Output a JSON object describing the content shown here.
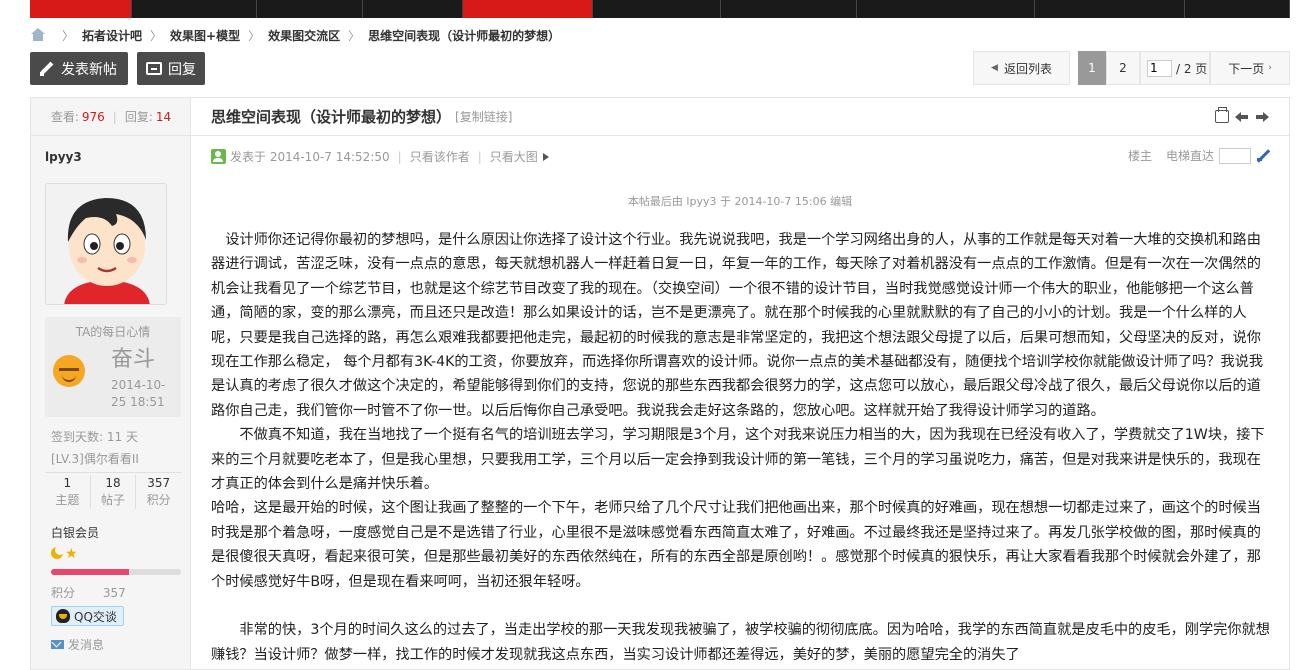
{
  "nav": {
    "items": [
      "",
      "",
      "",
      "",
      "",
      "",
      "",
      "",
      "",
      ""
    ]
  },
  "breadcrumb": [
    "拓者设计吧",
    "效果图+模型",
    "效果图交流区",
    "思维空间表现（设计师最初的梦想）"
  ],
  "actions": {
    "new_post": "发表新帖",
    "reply": "回复"
  },
  "pager": {
    "back": "返回列表",
    "pages": [
      "1",
      "2"
    ],
    "input_value": "1",
    "total": "/ 2 页",
    "next": "下一页"
  },
  "stats": {
    "views_label": "查看:",
    "views": "976",
    "replies_label": "回复:",
    "replies": "14"
  },
  "thread": {
    "title": "思维空间表现（设计师最初的梦想）",
    "copy_link": "[复制链接]"
  },
  "author": {
    "name": "lpyy3",
    "mood_title": "TA的每日心情",
    "mood_word": "奋斗",
    "mood_date": "2014-10-25 18:51",
    "sign_days": "签到天数: 11 天",
    "sign_level": "[LV.3]偶尔看看II",
    "counts": [
      {
        "value": "1",
        "label": "主题"
      },
      {
        "value": "18",
        "label": "帖子"
      },
      {
        "value": "357",
        "label": "积分"
      }
    ],
    "rank": "白银会员",
    "progress": 0.6,
    "points_label": "积分",
    "points": "357",
    "qq": "QQ交谈",
    "message": "发消息"
  },
  "meta": {
    "posted": "发表于 2014-10-7 14:52:50",
    "only_author": "只看该作者",
    "large_image": "只看大图",
    "floor_label": "楼主",
    "jump_label": "电梯直达"
  },
  "edit_note": "本帖最后由 lpyy3 于 2014-10-7 15:06 编辑",
  "content": {
    "paragraphs": [
      "　设计师你还记得你最初的梦想吗，是什么原因让你选择了设计这个行业。我先说说我吧，我是一个学习网络出身的人，从事的工作就是每天对着一大堆的交换机和路由器进行调试，苦涩乏味，没有一点点的意思，每天就想机器人一样赶着日复一日，年复一年的工作，每天除了对着机器没有一点点的工作激情。但是有一次在一次偶然的机会让我看见了一个综艺节目，也就是这个综艺节目改变了我的现在。（交换空间）一个很不错的设计节目，当时我觉感觉设计师一个伟大的职业，他能够把一个这么普通，简陋的家，变的那么漂亮，而且还只是改造！那么如果设计的话，岂不是更漂亮了。就在那个时候我的心里就默默的有了自己的小小的计划。我是一个什么样的人呢，只要是我自己选择的路，再怎么艰难我都要把他走完，最起初的时候我的意志是非常坚定的，我把这个想法跟父母提了以后，后果可想而知，父母坚决的反对，说你现在工作那么稳定， 每个月都有3K-4K的工资，你要放弃，而选择你所谓喜欢的设计师。说你一点点的美术基础都没有，随便找个培训学校你就能做设计师了吗？我说我是认真的考虑了很久才做这个决定的，希望能够得到你们的支持，您说的那些东西我都会很努力的学，这点您可以放心，最后跟父母冷战了很久，最后父母说你以后的道路你自己走，我们管你一时管不了你一世。以后后悔你自己承受吧。我说我会走好这条路的，您放心吧。这样就开始了我得设计师学习的道路。",
      "　　不做真不知道，我在当地找了一个挺有名气的培训班去学习，学习期限是3个月，这个对我来说压力相当的大，因为我现在已经没有收入了，学费就交了1W块，接下来的三个月就要吃老本了，但是我心里想，只要我用工学，三个月以后一定会挣到我设计师的第一笔钱，三个月的学习虽说吃力，痛苦，但是对我来讲是快乐的，我现在才真正的体会到什么是痛并快乐着。",
      "哈哈，这是最开始的时候，这个图让我画了整整的一个下午，老师只给了几个尺寸让我们把他画出来，那个时候真的好难画，现在想想一切都走过来了，画这个的时候当时我是那个着急呀，一度感觉自己是不是选错了行业，心里很不是滋味感觉看东西简直太难了，好难画。不过最终我还是坚持过来了。再发几张学校做的图，那时候真的是很傻很天真呀，看起来很可笑，但是那些最初美好的东西依然纯在，所有的东西全部是原创哟！。感觉那个时候真的狠快乐，再让大家看看我那个时候就会外建了，那个时候感觉好牛B呀，但是现在看来呵呵，当初还狠年轻呀。",
      "　　非常的快，3个月的时间久这么的过去了，当走出学校的那一天我发现我被骗了，被学校骗的彻彻底底。因为哈哈，我学的东西简直就是皮毛中的皮毛，刚学完你就想赚钱？当设计师？做梦一样，找工作的时候才发现就我这点东西，当实习设计师都还差得远，美好的梦，美丽的愿望完全的消失了"
    ]
  },
  "colors": {
    "accent": "#d71918",
    "dark_button": "#4a4a4a",
    "progress": "#e8466b"
  },
  "icons": [
    "home-icon",
    "pencil-icon",
    "reply-icon",
    "printer-icon",
    "arrow-left-icon",
    "arrow-right-icon",
    "user-online-icon",
    "play-icon",
    "go-icon",
    "moon-icon",
    "star-icon",
    "qq-icon",
    "mail-icon"
  ]
}
